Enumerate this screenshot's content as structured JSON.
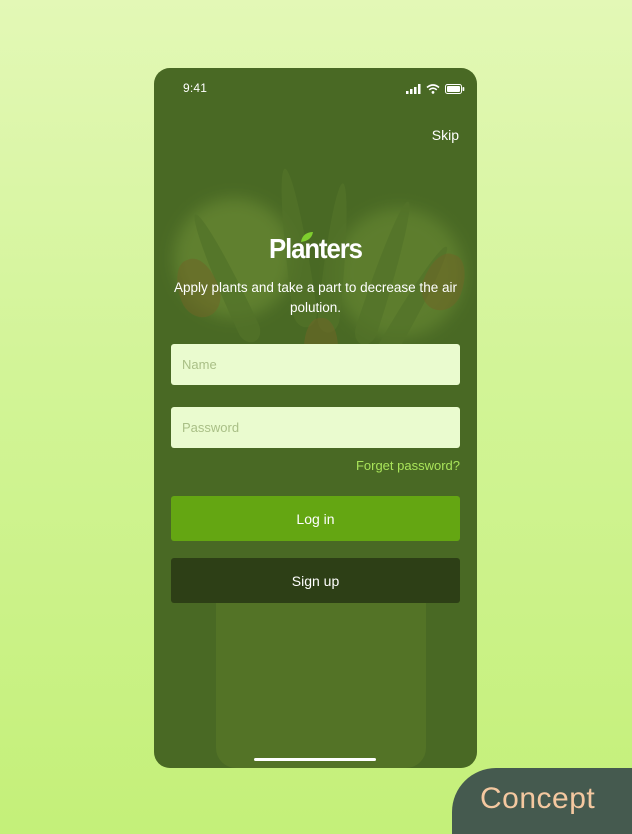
{
  "status_bar": {
    "time": "9:41",
    "icons": [
      "signal-icon",
      "wifi-icon",
      "battery-icon"
    ]
  },
  "header": {
    "skip_label": "Skip"
  },
  "brand": {
    "logo_text": "Planters",
    "tagline": "Apply plants and take a part to decrease the air polution."
  },
  "form": {
    "name_placeholder": "Name",
    "name_value": "",
    "password_placeholder": "Password",
    "password_value": "",
    "forgot_label": "Forget password?"
  },
  "actions": {
    "login_label": "Log in",
    "signup_label": "Sign up"
  },
  "badge": {
    "label": "Concept"
  },
  "colors": {
    "background": "#cdf28c",
    "overlay": "#4f6f2a",
    "input_bg": "#eafbcf",
    "accent_link": "#a9e45a",
    "login_button": "#64a612",
    "signup_button": "#2d3f16",
    "badge_bg": "#455a4f",
    "badge_text": "#f4c8a0"
  }
}
